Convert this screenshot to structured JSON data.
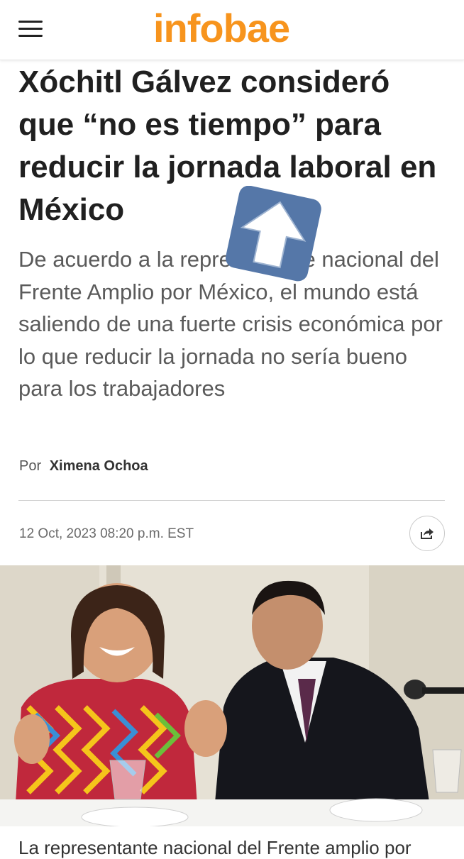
{
  "header": {
    "logo": "infobae",
    "menu_icon": "hamburger-menu-icon",
    "brand_color": "#f7941d"
  },
  "article": {
    "headline": "Xóchitl Gálvez consideró que “no es tiempo” para reducir la jornada laboral en México",
    "deck": "De acuerdo a la representante nacional del Frente Amplio por México, el mundo está saliendo de una fuerte crisis económica por lo que reducir la jornada no sería bueno para los trabajadores",
    "byline_prefix": "Por",
    "author": "Ximena Ochoa",
    "date": "12 Oct, 2023 08:20 p.m. EST",
    "share_icon": "share-icon",
    "body_start": "La representante nacional del Frente amplio por"
  },
  "overlay": {
    "icon": "up-arrow-icon",
    "color": "#5577a8"
  }
}
